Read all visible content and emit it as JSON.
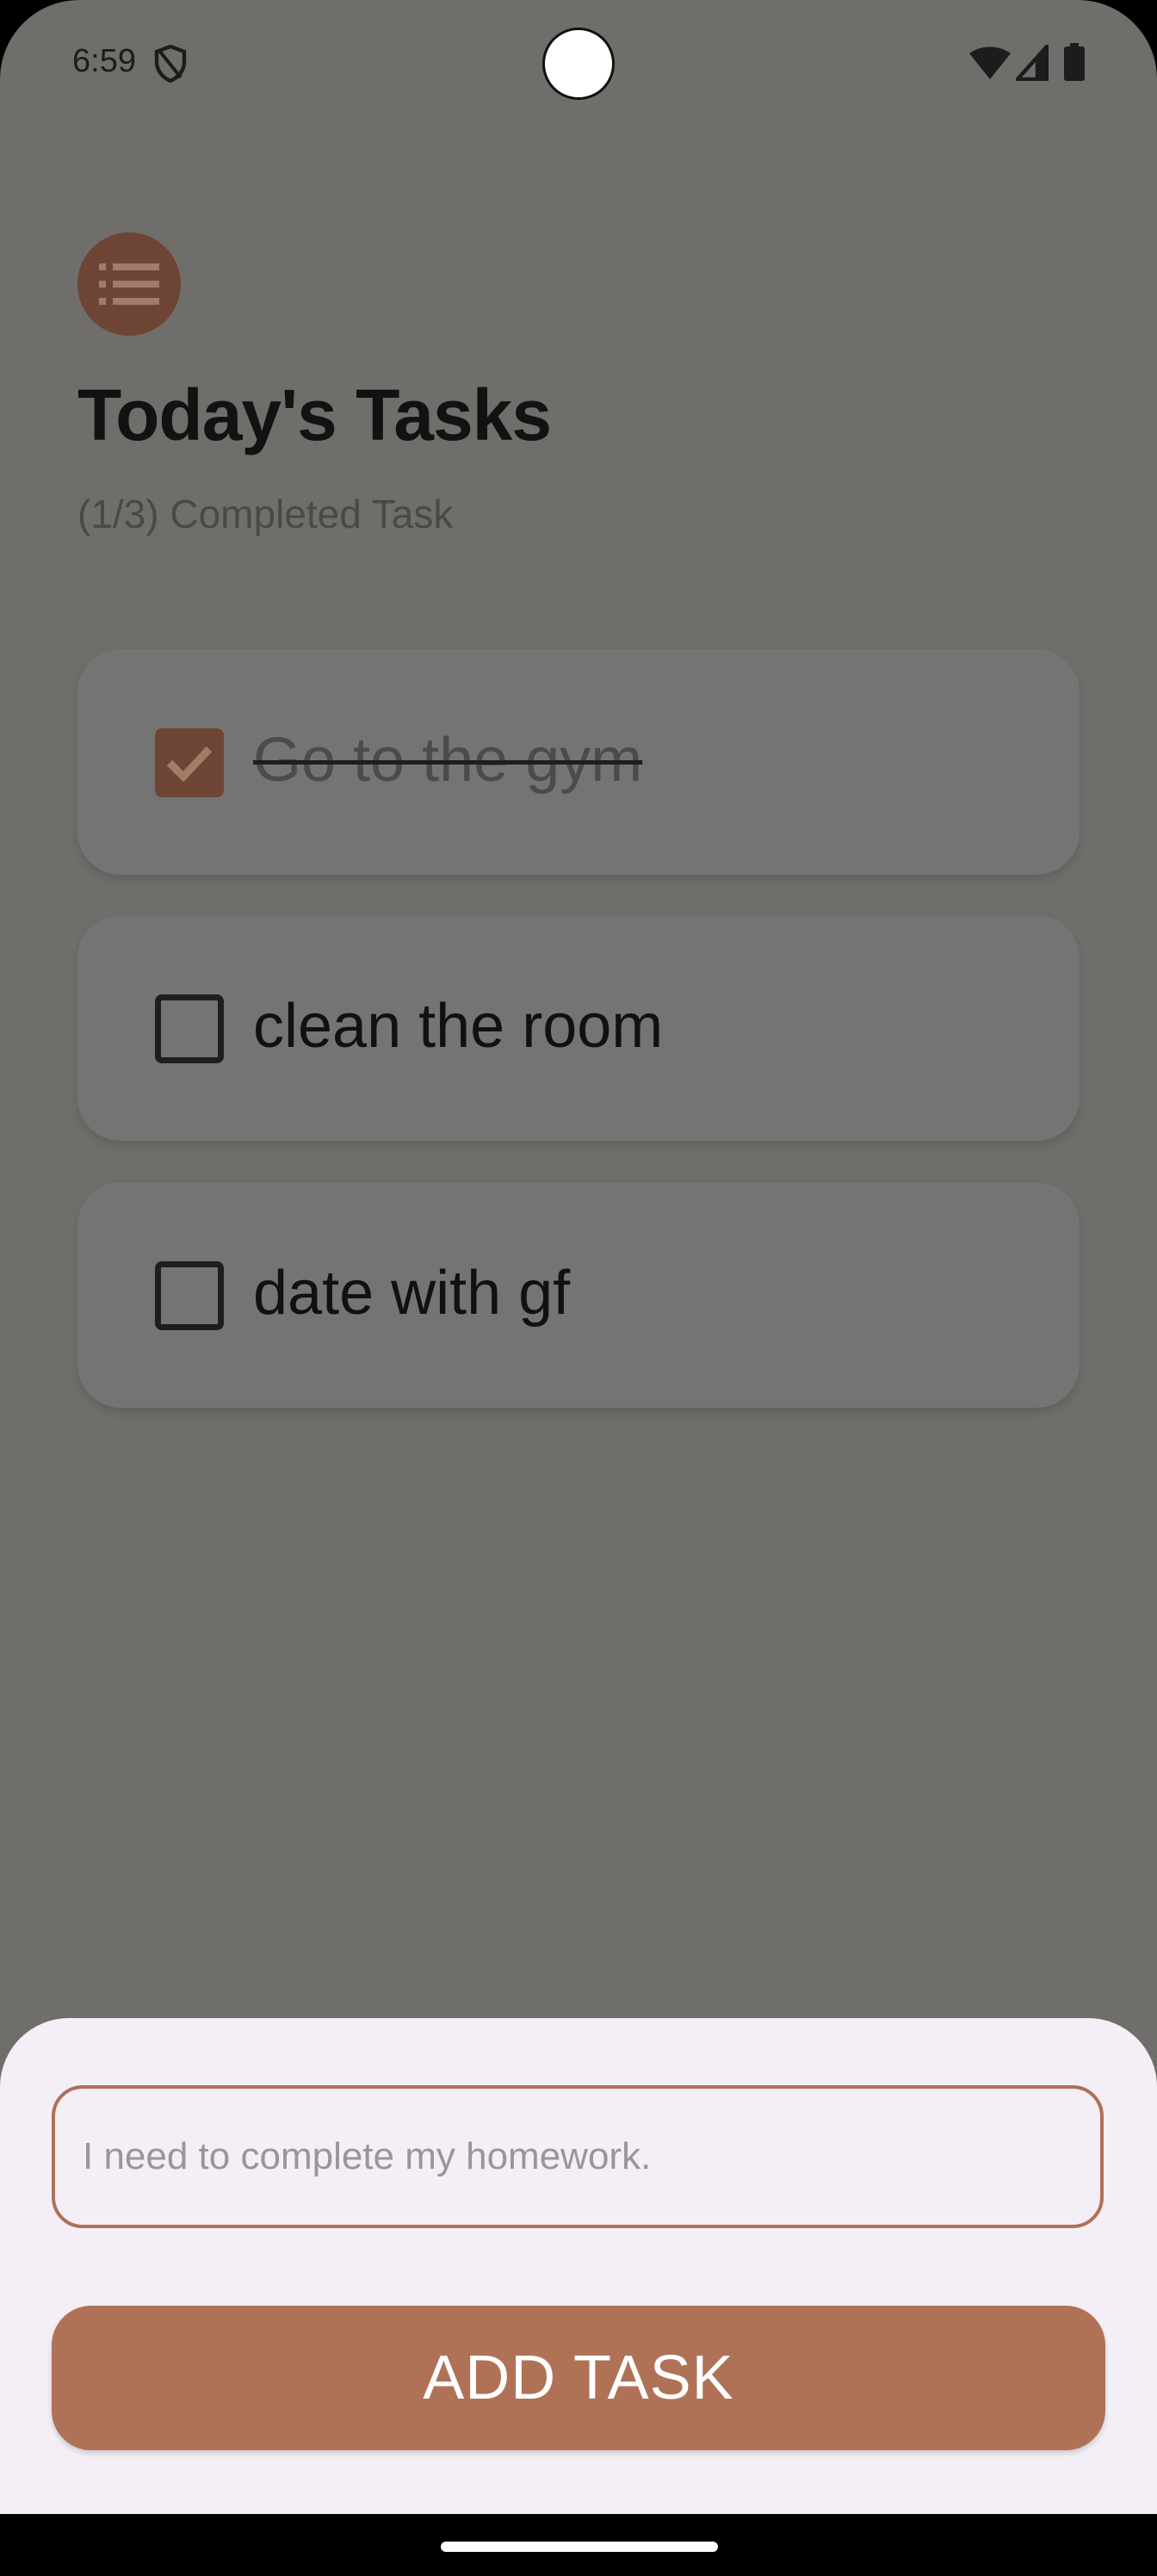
{
  "status_bar": {
    "time": "6:59",
    "icons": [
      "shield-icon",
      "camera-icon",
      "wifi-icon",
      "signal-icon",
      "battery-icon"
    ]
  },
  "header": {
    "logo_icon": "list-icon",
    "title": "Today's Tasks",
    "completed_counter": "(1/3) Completed Task"
  },
  "tasks": [
    {
      "label": "Go to the gym",
      "completed": true
    },
    {
      "label": "clean the room",
      "completed": false
    },
    {
      "label": "date with gf",
      "completed": false
    }
  ],
  "bottom_sheet": {
    "input_placeholder": "I need to complete my homework.",
    "input_value": "",
    "add_button_label": "ADD TASK"
  },
  "colors": {
    "accent": "#b07256",
    "accent_dark": "#6e4535",
    "scrim_background": "#6f6e6a",
    "card_background": "#747474",
    "sheet_background": "#f4eff6"
  }
}
